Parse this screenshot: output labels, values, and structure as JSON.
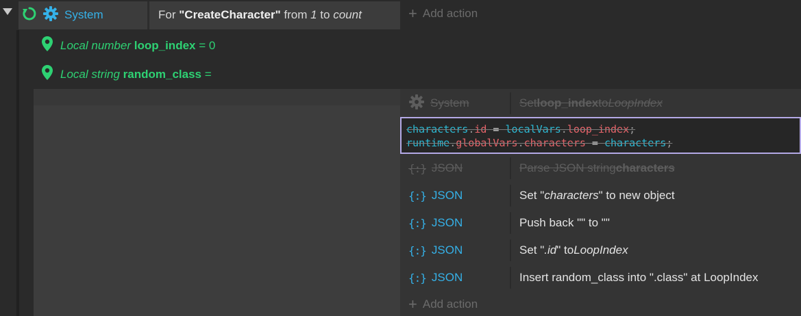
{
  "event": {
    "condition": {
      "object": "System",
      "text_prefix": "For ",
      "loop_name": "\"CreateCharacter\"",
      "text_from": " from ",
      "start": "1",
      "text_to": " to ",
      "end": "count"
    },
    "add_action_label": "Add action"
  },
  "local_vars": [
    {
      "kind": "Local number",
      "name": "loop_index",
      "value": "= 0"
    },
    {
      "kind": "Local string",
      "name": "random_class",
      "value": "="
    }
  ],
  "sub_event": {
    "actions": {
      "system_row": {
        "object": "System",
        "text_pre": "Set ",
        "bold": "loop_index",
        "text_mid": " to ",
        "italic": "LoopIndex"
      },
      "script": {
        "line1": {
          "a": "characters",
          "dot1": ".",
          "b": "id",
          "eq": " = ",
          "c": "localVars",
          "dot2": ".",
          "d": "loop_index",
          "semi": ";"
        },
        "line2": {
          "a": "runtime",
          "dot1": ".",
          "b": "globalVars",
          "dot2": ".",
          "c": "characters",
          "eq": " = ",
          "d": "characters",
          "semi": ";"
        }
      },
      "json_icon": "{:}",
      "json_label": "JSON",
      "parse_row": {
        "text_pre": "Parse JSON string ",
        "bold": "characters"
      },
      "set_chars_row": {
        "text_pre": "Set \"",
        "italic": "characters",
        "text_post": "\" to new object"
      },
      "push_row": {
        "text": "Push back \"\" to \"\""
      },
      "set_id_row": {
        "text_pre": "Set \"",
        "italic": ".id",
        "text_mid": "\" to ",
        "italic2": "LoopIndex"
      },
      "insert_row": {
        "text": "Insert random_class into \".class\" at LoopIndex"
      }
    },
    "add_action_label": "Add action"
  },
  "colors": {
    "system_blue": "#35b1e8",
    "local_var_green": "#2ed173",
    "script_border": "#b4a9e6",
    "code_cyan": "#2bbbd6",
    "code_red": "#e8646a"
  }
}
